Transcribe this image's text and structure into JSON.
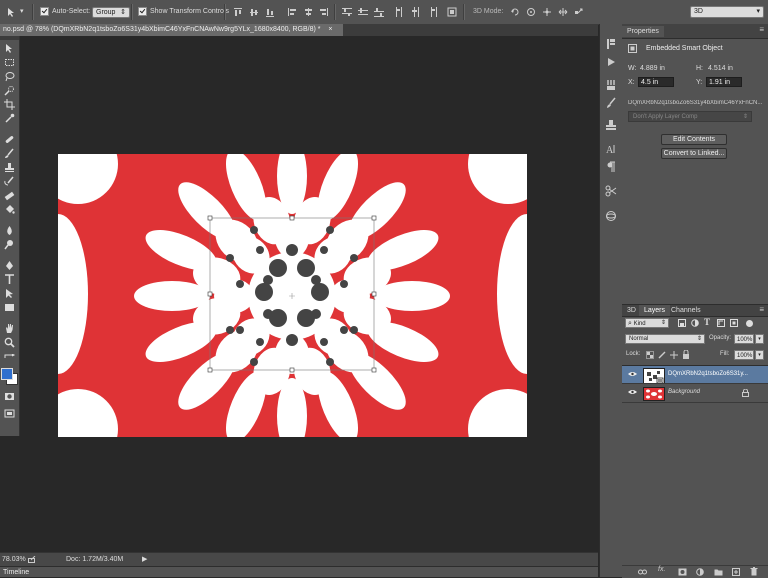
{
  "options_bar": {
    "auto_select_label": "Auto-Select:",
    "auto_select_target": "Group",
    "show_transform_label": "Show Transform Controls",
    "mode_label": "3D Mode:",
    "workspace": "3D"
  },
  "document": {
    "tab_title": "no.psd @ 78% (DQmXRbN2q1tsboZo6S31y4bXbimC46YxFnCNAwNw9rg5YLx_1680x8400, RGB/8) *",
    "close_glyph": "×"
  },
  "status": {
    "zoom": "78.03%",
    "doc_size": "Doc: 1.72M/3.40M"
  },
  "timeline_label": "Timeline",
  "properties": {
    "tab_label": "Properties",
    "object_type": "Embedded Smart Object",
    "w_label": "W:",
    "w_value": "4.889 in",
    "h_label": "H:",
    "h_value": "4.514 in",
    "x_label": "X:",
    "x_value": "4.5 in",
    "y_label": "Y:",
    "y_value": "1.91 in",
    "object_name": "DQmXRbN2q1tsboZo6S31y4bXbimC46YxFnCN...",
    "layer_comp": "Don't Apply Layer Comp",
    "edit_contents": "Edit Contents",
    "convert_linked": "Convert to Linked..."
  },
  "layers_panel": {
    "tabs": [
      "3D",
      "Layers",
      "Channels"
    ],
    "filter_kind": "Kind",
    "blend_mode": "Normal",
    "opacity_label": "Opacity:",
    "opacity_value": "100%",
    "lock_label": "Lock:",
    "fill_label": "Fill:",
    "fill_value": "100%",
    "layers": [
      {
        "name": "DQmXRbN2q1tsboZo6S31y...",
        "selected": true
      },
      {
        "name": "Background",
        "selected": false
      }
    ]
  },
  "colors": {
    "artwork_red": "#df3336",
    "artwork_white": "#ffffff",
    "dots": "#444444",
    "foreground": "#2f6fce",
    "background": "#ffffff",
    "selected_layer": "#5b7aa0"
  }
}
